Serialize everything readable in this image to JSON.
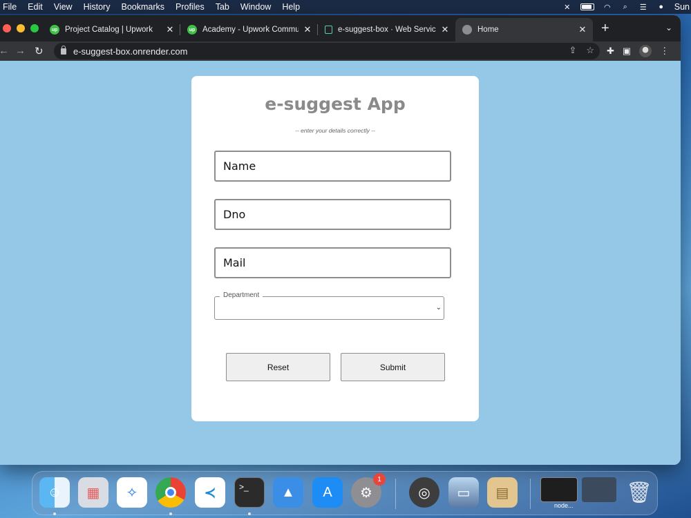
{
  "menubar": {
    "items": [
      "File",
      "Edit",
      "View",
      "History",
      "Bookmarks",
      "Profiles",
      "Tab",
      "Window",
      "Help"
    ],
    "clock_text": "Sun"
  },
  "browser": {
    "tabs": [
      {
        "title": "Project Catalog | Upwork",
        "favicon": "upwork-icon"
      },
      {
        "title": "Academy - Upwork Community",
        "favicon": "upwork-icon"
      },
      {
        "title": "e-suggest-box · Web Service",
        "favicon": "render-icon"
      },
      {
        "title": "Home",
        "favicon": "globe-icon",
        "active": true
      }
    ],
    "url": "e-suggest-box.onrender.com"
  },
  "form": {
    "title": "e-suggest App",
    "subtitle": "-- enter your details correctly --",
    "name_placeholder": "Name",
    "dno_placeholder": "Dno",
    "mail_placeholder": "Mail",
    "department_label": "Department",
    "department_value": "",
    "reset_label": "Reset",
    "submit_label": "Submit"
  },
  "dock": {
    "apps": [
      "Finder",
      "Launchpad",
      "Safari",
      "Chrome",
      "VS Code",
      "Terminal",
      "Keynote",
      "App Store",
      "System Preferences",
      "QuickTime Player",
      "Preview",
      "Archive Utility"
    ],
    "system_preferences_badge": "1",
    "minimized_label": "node..."
  }
}
